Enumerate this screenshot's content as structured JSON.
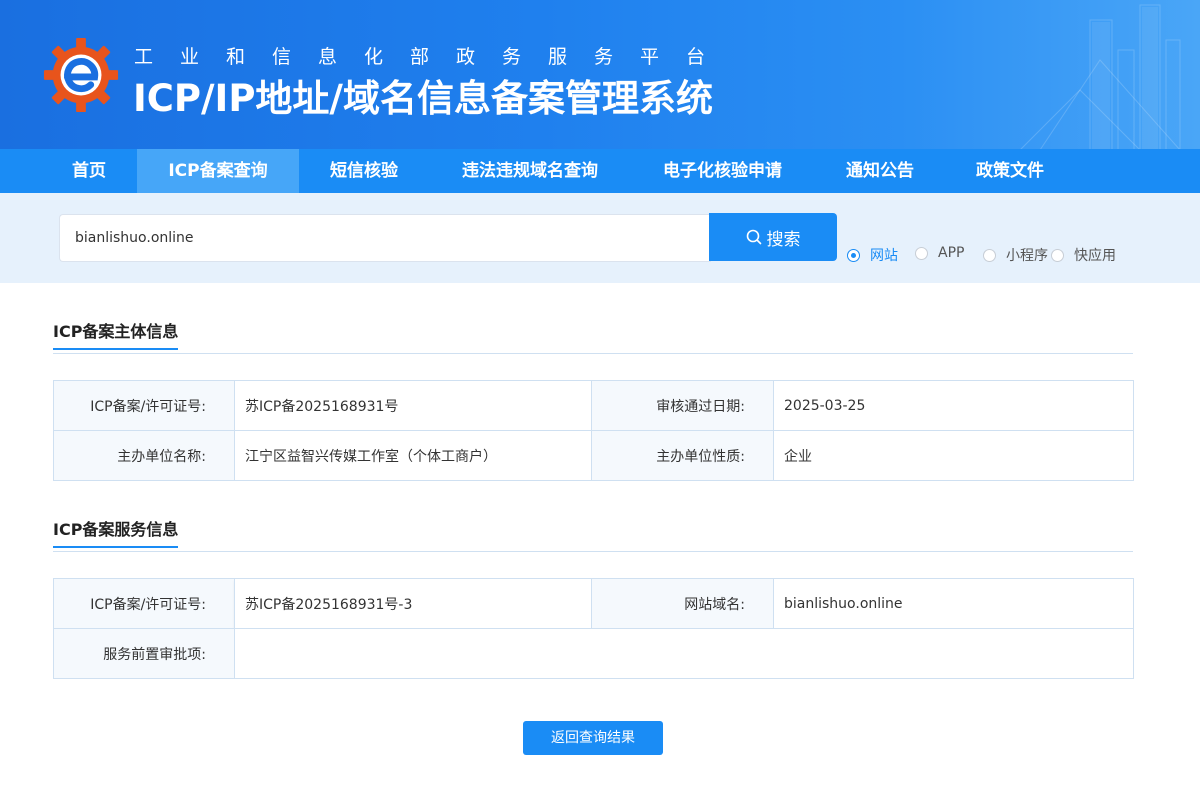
{
  "header": {
    "subtitle": "工业和信息化部政务服务平台",
    "title": "ICP/IP地址/域名信息备案管理系统"
  },
  "nav": {
    "items": [
      "首页",
      "ICP备案查询",
      "短信核验",
      "违法违规域名查询",
      "电子化核验申请",
      "通知公告",
      "政策文件"
    ],
    "active_index": 1
  },
  "search": {
    "value": "bianlishuo.online",
    "button_label": "搜索",
    "types": [
      "网站",
      "APP",
      "小程序",
      "快应用"
    ],
    "selected_type": "网站"
  },
  "subject_section": {
    "title": "ICP备案主体信息",
    "rows": [
      {
        "k1": "ICP备案/许可证号:",
        "v1": "苏ICP备2025168931号",
        "k2": "审核通过日期:",
        "v2": "2025-03-25"
      },
      {
        "k1": "主办单位名称:",
        "v1": "江宁区益智兴传媒工作室（个体工商户）",
        "k2": "主办单位性质:",
        "v2": "企业"
      }
    ]
  },
  "service_section": {
    "title": "ICP备案服务信息",
    "rows": [
      {
        "k1": "ICP备案/许可证号:",
        "v1": "苏ICP备2025168931号-3",
        "k2": "网站域名:",
        "v2": "bianlishuo.online"
      },
      {
        "k1": "服务前置审批项:",
        "v1": ""
      }
    ]
  },
  "back_button_label": "返回查询结果",
  "colors": {
    "primary": "#1a8cf5",
    "nav_active": "#46a6f8",
    "search_band": "#e6f1fc",
    "border": "#cfe0f1"
  }
}
